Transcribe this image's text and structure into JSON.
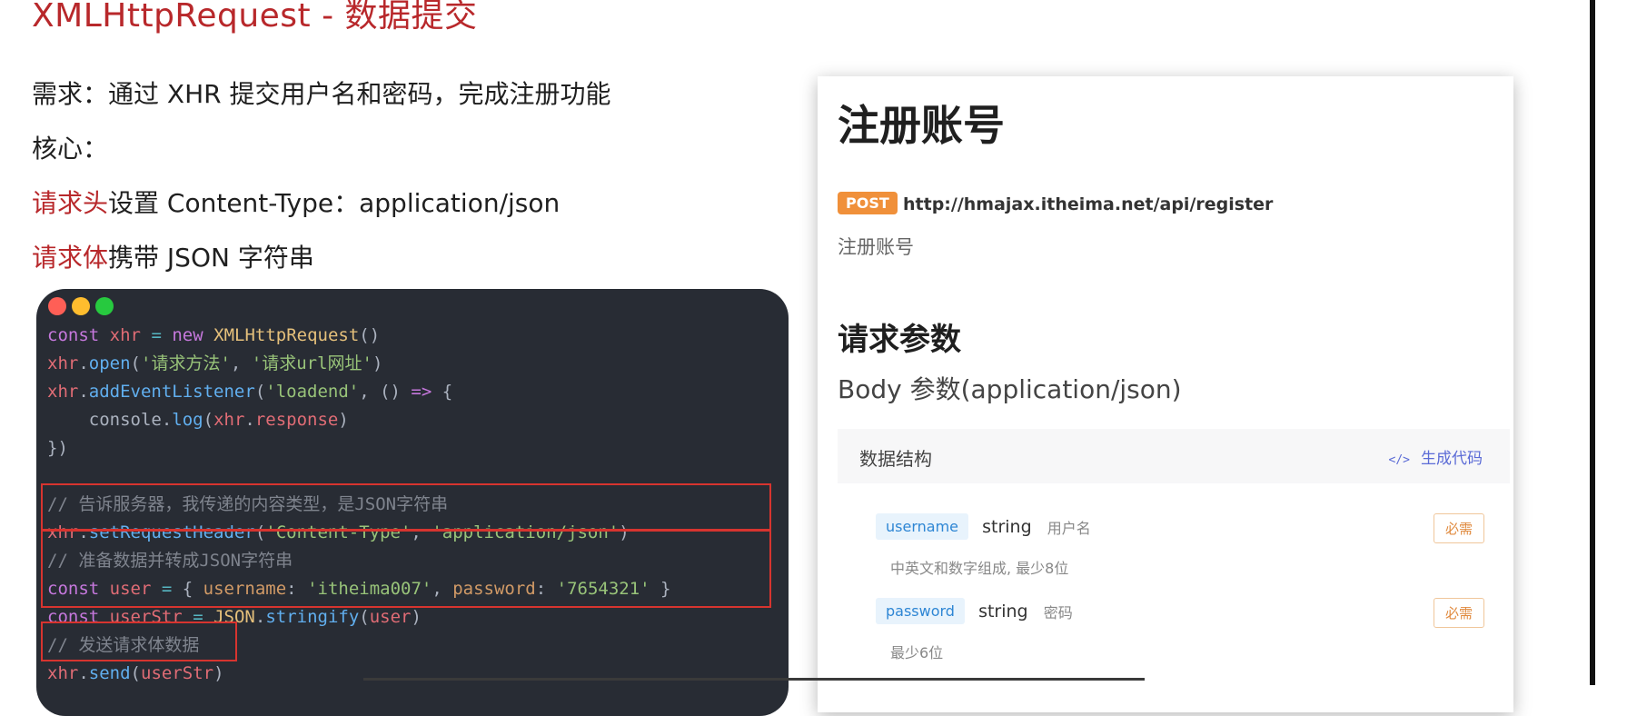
{
  "slide": {
    "title": "XMLHttpRequest - 数据提交",
    "lines": {
      "requirement": "需求：通过 XHR 提交用户名和密码，完成注册功能",
      "core": "核心：",
      "header_hl": "请求头",
      "header_rest": "设置 Content-Type：application/json",
      "body_hl": "请求体",
      "body_rest": "携带 JSON 字符串"
    },
    "accent_color": "#b8282b"
  },
  "code_window": {
    "window_controls": [
      "close-dot",
      "minimize-dot",
      "maximize-dot"
    ],
    "lines": [
      "const xhr = new XMLHttpRequest()",
      "xhr.open('请求方法', '请求url网址')",
      "xhr.addEventListener('loadend', () => {",
      "    console.log(xhr.response)",
      "})",
      "",
      "// 告诉服务器，我传递的内容类型，是JSON字符串",
      "xhr.setRequestHeader('Content-Type', 'application/json')",
      "// 准备数据并转成JSON字符串",
      "const user = { username: 'itheima007', password: '7654321' }",
      "const userStr = JSON.stringify(user)",
      "// 发送请求体数据",
      "xhr.send(userStr)"
    ],
    "highlight_color": "#d7342f"
  },
  "doc": {
    "title": "注册账号",
    "method": "POST",
    "url": "http://hmajax.itheima.net/api/register",
    "subtitle": "注册账号",
    "section_title": "请求参数",
    "body_label": "Body 参数(application/json)",
    "struct_label": "数据结构",
    "generate_code": "生成代码",
    "params": [
      {
        "name": "username",
        "type": "string",
        "desc": "用户名",
        "note": "中英文和数字组成, 最少8位",
        "required": "必需"
      },
      {
        "name": "password",
        "type": "string",
        "desc": "密码",
        "note": "最少6位",
        "required": "必需"
      }
    ],
    "colors": {
      "method": "#f0903a",
      "param_name": "#2e86d4",
      "required": "#e08a3e"
    }
  }
}
